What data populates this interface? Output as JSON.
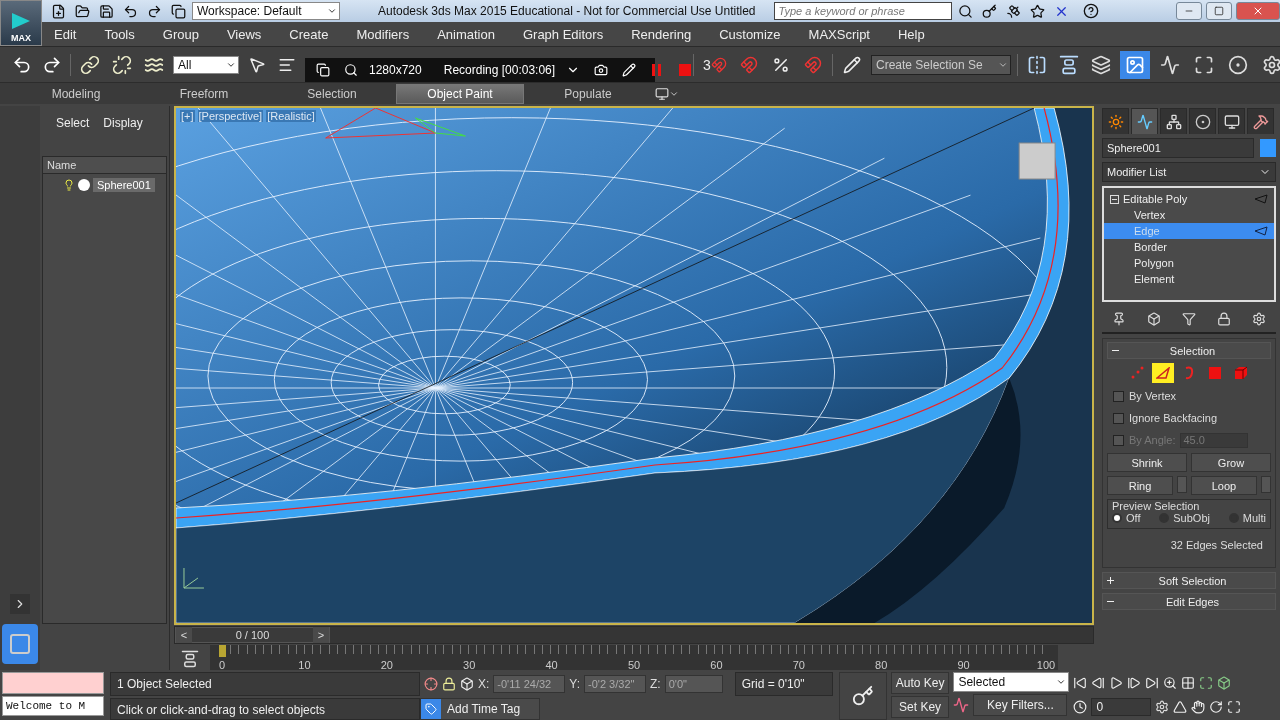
{
  "app_button": {
    "label": "MAX"
  },
  "title_bar": {
    "workspace": "Workspace: Default",
    "title": "Autodesk 3ds Max  2015  Educational - Not for Commercial Use   Untitled",
    "search": {
      "placeholder": "Type a keyword or phrase"
    }
  },
  "menu": [
    "Edit",
    "Tools",
    "Group",
    "Views",
    "Create",
    "Modifiers",
    "Animation",
    "Graph Editors",
    "Rendering",
    "Customize",
    "MAXScript",
    "Help"
  ],
  "toolbar": {
    "selection_filter": "All",
    "snap_label": "3",
    "named_selection": "Create Selection Se"
  },
  "recorder": {
    "resolution": "1280x720",
    "status": "Recording [00:03:06]"
  },
  "ribbon_tabs": [
    {
      "label": "Modeling",
      "selected": false
    },
    {
      "label": "Freeform",
      "selected": false
    },
    {
      "label": "Selection",
      "selected": false
    },
    {
      "label": "Object Paint",
      "selected": true
    },
    {
      "label": "Populate",
      "selected": false
    }
  ],
  "scene_explorer": {
    "tabs": [
      "Select",
      "Display"
    ],
    "column": "Name",
    "items": [
      {
        "name": "Sphere001",
        "selected": true
      }
    ]
  },
  "viewport": {
    "labels": [
      "[+]",
      "[Perspective]",
      "[Realistic]"
    ]
  },
  "command_panel": {
    "tabs": [
      {
        "kind": "create",
        "selected": false
      },
      {
        "kind": "modify",
        "selected": true
      },
      {
        "kind": "hierarchy",
        "selected": false
      },
      {
        "kind": "motion",
        "selected": false
      },
      {
        "kind": "display",
        "selected": false
      },
      {
        "kind": "utilities",
        "selected": false
      }
    ],
    "object_name": "Sphere001",
    "modifier_list": "Modifier List",
    "stack": [
      {
        "label": "Editable Poly",
        "expanded": true,
        "children": [
          {
            "label": "Vertex",
            "selected": false
          },
          {
            "label": "Edge",
            "selected": true
          },
          {
            "label": "Border",
            "selected": false
          },
          {
            "label": "Polygon",
            "selected": false
          },
          {
            "label": "Element",
            "selected": false
          }
        ]
      }
    ],
    "selection": {
      "title": "Selection",
      "expanded": true,
      "modes": [
        {
          "kind": "vertex",
          "selected": false
        },
        {
          "kind": "edge",
          "selected": true
        },
        {
          "kind": "border",
          "selected": false
        },
        {
          "kind": "polygon",
          "selected": false
        },
        {
          "kind": "element",
          "selected": false
        }
      ],
      "options": [
        {
          "label": "By Vertex",
          "checked": false,
          "disabled": false
        },
        {
          "label": "Ignore Backfacing",
          "checked": false,
          "disabled": false
        },
        {
          "label": "By Angle:",
          "checked": false,
          "disabled": true,
          "value": "45.0"
        }
      ],
      "buttons": [
        "Shrink",
        "Grow"
      ],
      "spinner_buttons": [
        "Ring",
        "Loop"
      ],
      "preview": {
        "title": "Preview Selection",
        "options": [
          {
            "label": "Off",
            "selected": true
          },
          {
            "label": "SubObj",
            "selected": false
          },
          {
            "label": "Multi",
            "selected": false
          }
        ]
      },
      "status": "32 Edges Selected"
    },
    "rollouts": [
      {
        "title": "Soft Selection",
        "expanded": false
      },
      {
        "title": "Edit Edges",
        "expanded": true
      }
    ]
  },
  "time_slider": {
    "prev": "<",
    "label": "0 / 100",
    "next": ">",
    "level": 0
  },
  "track_bar": {
    "ticks": [
      "0",
      "10",
      "20",
      "30",
      "40",
      "50",
      "60",
      "70",
      "80",
      "90",
      "100"
    ]
  },
  "listener": {
    "output": "Welcome to M"
  },
  "status_bar": {
    "selection": "1 Object Selected",
    "prompt": "Click or click-and-drag to select objects",
    "x_label": "X:",
    "x": "-0'11 24/32",
    "y_label": "Y:",
    "y": "-0'2 3/32\"",
    "z_label": "Z:",
    "z": "0'0\"",
    "grid": "Grid = 0'10\"",
    "add_time_tag": "Add Time Tag"
  },
  "animation": {
    "auto_key": "Auto Key",
    "set_key": "Set Key",
    "key_mode": "Selected",
    "key_filters": "Key Filters...",
    "frame": "0"
  }
}
